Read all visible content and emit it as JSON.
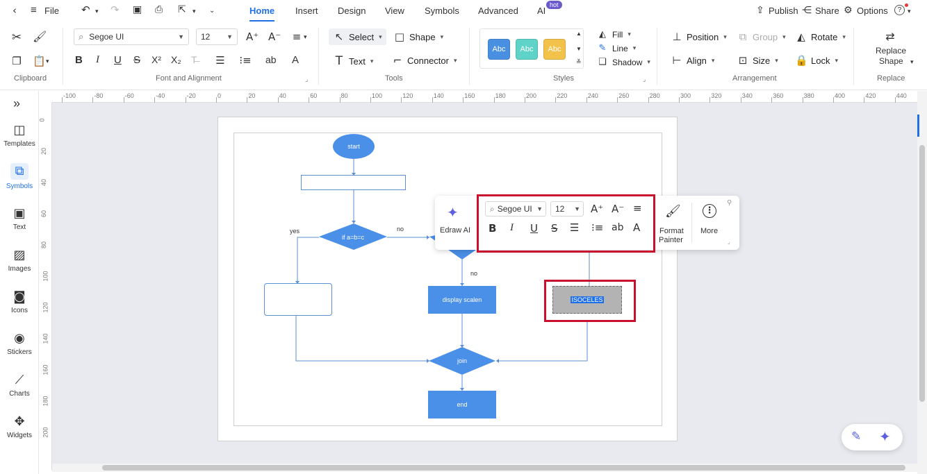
{
  "menubar": {
    "file_label": "File",
    "tabs": [
      "Home",
      "Insert",
      "Design",
      "View",
      "Symbols",
      "Advanced",
      "AI"
    ],
    "hot_badge": "hot",
    "publish": "Publish",
    "share": "Share",
    "options": "Options",
    "help": "?"
  },
  "ribbon": {
    "groups": {
      "clipboard": "Clipboard",
      "font": "Font and Alignment",
      "tools": "Tools",
      "styles": "Styles",
      "arrangement": "Arrangement",
      "replace": "Replace"
    },
    "font_name": "Segoe UI",
    "font_size": "12",
    "select": "Select",
    "shape": "Shape",
    "text": "Text",
    "connector": "Connector",
    "style_swatches": [
      {
        "label": "Abc",
        "color": "#4a90e2"
      },
      {
        "label": "Abc",
        "color": "#5fd3c8"
      },
      {
        "label": "Abc",
        "color": "#f3c24a"
      }
    ],
    "fill": "Fill",
    "line": "Line",
    "shadow": "Shadow",
    "position": "Position",
    "group": "Group",
    "rotate": "Rotate",
    "align": "Align",
    "size": "Size",
    "lock": "Lock",
    "replace_shape_1": "Replace",
    "replace_shape_2": "Shape"
  },
  "sidebar": {
    "items": [
      "Templates",
      "Symbols",
      "Text",
      "Images",
      "Icons",
      "Stickers",
      "Charts",
      "Widgets"
    ]
  },
  "rulers": {
    "h": [
      "-100",
      "-80",
      "-60",
      "-40",
      "-20",
      "0",
      "20",
      "40",
      "60",
      "80",
      "100",
      "120",
      "140",
      "160",
      "180",
      "200",
      "220",
      "240",
      "260",
      "280",
      "300",
      "320",
      "340",
      "360",
      "380",
      "400",
      "420",
      "440"
    ],
    "v": [
      "0",
      "20",
      "40",
      "60",
      "80",
      "100",
      "120",
      "140",
      "160",
      "180",
      "200"
    ]
  },
  "flowchart": {
    "start": "start",
    "decision1": "if a=b=c",
    "yes": "yes",
    "no1": "no",
    "no2": "no",
    "display": "display scalen",
    "selected": "ISOCELES",
    "join": "join",
    "end": "end"
  },
  "float_toolbar": {
    "edraw_ai": "Edraw AI",
    "font": "Segoe UI",
    "size": "12",
    "format_painter_1": "Format",
    "format_painter_2": "Painter",
    "more": "More"
  },
  "colors": {
    "accent": "#1f6fe5",
    "shape_blue": "#4a8fe8",
    "highlight_red": "#c8102e"
  }
}
